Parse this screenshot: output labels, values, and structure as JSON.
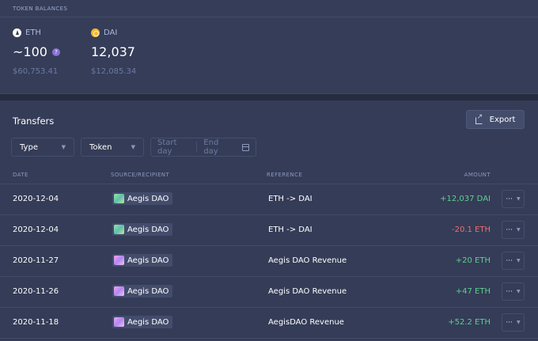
{
  "balances": {
    "heading": "TOKEN BALANCES",
    "tokens": [
      {
        "symbol": "ETH",
        "icon": "eth-icon",
        "amount": "~100",
        "help": "?",
        "fiat": "$60,753.41"
      },
      {
        "symbol": "DAI",
        "icon": "dai-icon",
        "amount": "12,037",
        "fiat": "$12,085.34"
      }
    ]
  },
  "transfers": {
    "title": "Transfers",
    "export_label": "Export",
    "filters": {
      "type": "Type",
      "token": "Token",
      "start_day": "Start day",
      "end_day": "End day"
    },
    "columns": {
      "date": "DATE",
      "source": "SOURCE/RECIPIENT",
      "reference": "REFERENCE",
      "amount": "AMOUNT"
    },
    "rows": [
      {
        "date": "2020-12-04",
        "source": "Aegis DAO",
        "reference": "ETH -> DAI",
        "amount": "+12,037 DAI",
        "direction": "in"
      },
      {
        "date": "2020-12-04",
        "source": "Aegis DAO",
        "reference": "ETH -> DAI",
        "amount": "-20.1 ETH",
        "direction": "out"
      },
      {
        "date": "2020-11-27",
        "source": "Aegis DAO",
        "reference": "Aegis DAO Revenue",
        "amount": "+20 ETH",
        "direction": "in"
      },
      {
        "date": "2020-11-26",
        "source": "Aegis DAO",
        "reference": "Aegis DAO Revenue",
        "amount": "+47 ETH",
        "direction": "in"
      },
      {
        "date": "2020-11-18",
        "source": "Aegis DAO",
        "reference": "AegisDAO Revenue",
        "amount": "+52.2 ETH",
        "direction": "in"
      }
    ],
    "more_label": "···"
  },
  "colors": {
    "positive": "#5fcf8f",
    "negative": "#f26d6d",
    "background": "#2b3249",
    "panel": "#353d58"
  }
}
